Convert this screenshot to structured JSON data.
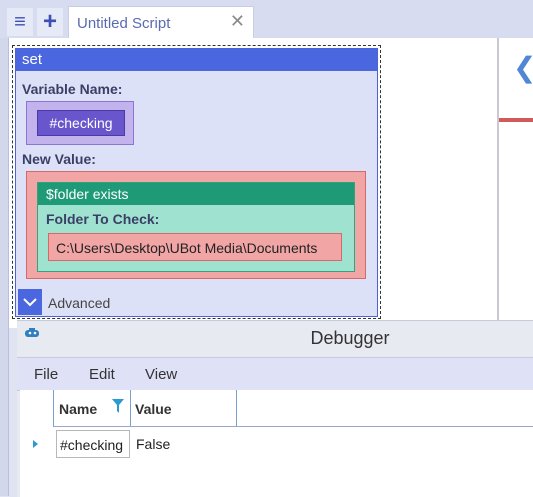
{
  "tab": {
    "title": "Untitled Script",
    "close_glyph": "✕"
  },
  "toolbar": {
    "menu_icon": "menu-icon",
    "add_icon": "plus-icon",
    "menu_glyph": "≡",
    "add_glyph": "+"
  },
  "script": {
    "set_command": {
      "header": "set",
      "variable_label": "Variable Name:",
      "variable_value": "#checking",
      "new_value_label": "New Value:",
      "folder_exists": {
        "header": "$folder exists",
        "folder_label": "Folder To Check:",
        "folder_value": "C:\\Users\\Desktop\\UBot Media\\Documents"
      },
      "advanced_label": "Advanced"
    }
  },
  "side_panel": {
    "arrow_icon": "arrow-left-icon",
    "arrow_glyph": "❮"
  },
  "debugger": {
    "title": "Debugger",
    "menu": [
      "File",
      "Edit",
      "View"
    ],
    "columns": {
      "name": "Name",
      "value": "Value"
    },
    "rows": [
      {
        "name": "#checking",
        "value": "False"
      }
    ]
  },
  "colors": {
    "set_header": "#4a67e0",
    "variable_block": "#6a56cc",
    "value_block": "#f1a5a5",
    "folder_exists_header": "#1f9a77"
  }
}
